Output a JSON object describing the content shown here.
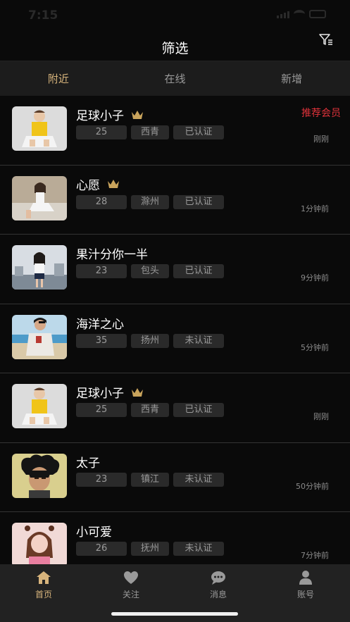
{
  "status": {
    "time": "7:15"
  },
  "header": {
    "title": "筛选"
  },
  "tabs": [
    {
      "label": "附近",
      "active": true
    },
    {
      "label": "在线",
      "active": false
    },
    {
      "label": "新增",
      "active": false
    }
  ],
  "users": [
    {
      "name": "足球小子",
      "crown": true,
      "age": "25",
      "city": "西青",
      "verify": "已认证",
      "time": "刚刚",
      "badge": "推荐会员",
      "avatar": "boy-yellow-shirt"
    },
    {
      "name": "心愿",
      "crown": true,
      "age": "28",
      "city": "滁州",
      "verify": "已认证",
      "time": "1分钟前",
      "badge": "",
      "avatar": "girl-sitting"
    },
    {
      "name": "果汁分你一半",
      "crown": false,
      "age": "23",
      "city": "包头",
      "verify": "已认证",
      "time": "9分钟前",
      "badge": "",
      "avatar": "girl-city"
    },
    {
      "name": "海洋之心",
      "crown": false,
      "age": "35",
      "city": "扬州",
      "verify": "未认证",
      "time": "5分钟前",
      "badge": "",
      "avatar": "man-beach"
    },
    {
      "name": "足球小子",
      "crown": true,
      "age": "25",
      "city": "西青",
      "verify": "已认证",
      "time": "刚刚",
      "badge": "",
      "avatar": "boy-yellow-shirt"
    },
    {
      "name": "太子",
      "crown": false,
      "age": "23",
      "city": "镇江",
      "verify": "未认证",
      "time": "50分钟前",
      "badge": "",
      "avatar": "man-wild-hair"
    },
    {
      "name": "小可爱",
      "crown": false,
      "age": "26",
      "city": "抚州",
      "verify": "未认证",
      "time": "7分钟前",
      "badge": "",
      "avatar": "girl-pink"
    }
  ],
  "tabbar": [
    {
      "label": "首页",
      "icon": "home-icon",
      "active": true
    },
    {
      "label": "关注",
      "icon": "heart-icon",
      "active": false
    },
    {
      "label": "消息",
      "icon": "message-icon",
      "active": false
    },
    {
      "label": "账号",
      "icon": "person-icon",
      "active": false
    }
  ],
  "colors": {
    "accent": "#d7b47c",
    "vip": "#e0323a",
    "background": "#0a0a0a",
    "tag_bg": "#2a2a2a"
  }
}
